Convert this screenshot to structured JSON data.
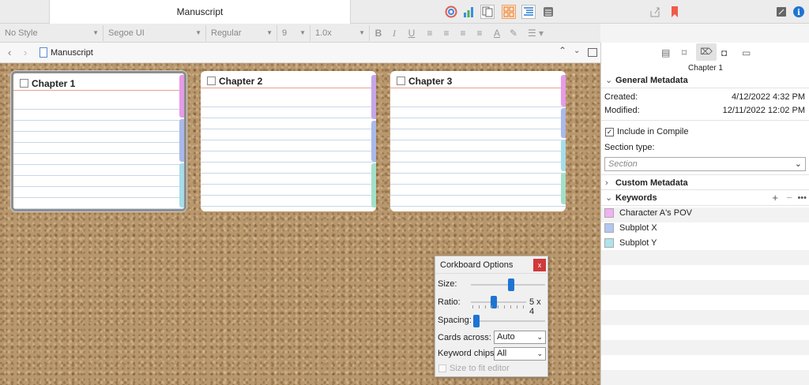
{
  "tab_title": "Manuscript",
  "format_bar": {
    "style": "No Style",
    "font": "Segoe UI",
    "weight": "Regular",
    "size": "9",
    "spacing": "1.0x"
  },
  "nav": {
    "title": "Manuscript"
  },
  "cards": [
    {
      "title": "Chapter 1",
      "chips": [
        "#e79be7",
        "#a9b9ea",
        "#a6dde8"
      ]
    },
    {
      "title": "Chapter 2",
      "chips": [
        "#c5a6e8",
        "#a9b9ea",
        "#a3e0c8"
      ]
    },
    {
      "title": "Chapter 3",
      "chips": [
        "#e79be7",
        "#a9b9ea",
        "#a6dde8",
        "#a3e0c8"
      ]
    }
  ],
  "options": {
    "title": "Corkboard Options",
    "close": "x",
    "size_label": "Size:",
    "size_value": 0.55,
    "ratio_label": "Ratio:",
    "ratio_text": "5 x 4",
    "ratio_value": 0.4,
    "spacing_label": "Spacing:",
    "spacing_value": 0.0,
    "cards_across_label": "Cards across:",
    "cards_across": "Auto",
    "keyword_chips_label": "Keyword chips:",
    "keyword_chips": "All",
    "fit_label": "Size to fit editor"
  },
  "inspector": {
    "doc_title": "Chapter 1",
    "general_header": "General Metadata",
    "created_label": "Created:",
    "created": "4/12/2022 4:32 PM",
    "modified_label": "Modified:",
    "modified": "12/11/2022 12:02 PM",
    "compile_label": "Include in Compile",
    "section_type_label": "Section type:",
    "section_type": "Section",
    "custom_header": "Custom Metadata",
    "keywords_header": "Keywords",
    "keywords": [
      {
        "name": "Character A's POV",
        "color": "#f3b0f3"
      },
      {
        "name": "Subplot X",
        "color": "#b4c6f0"
      },
      {
        "name": "Subplot Y",
        "color": "#aee3ea"
      }
    ]
  }
}
